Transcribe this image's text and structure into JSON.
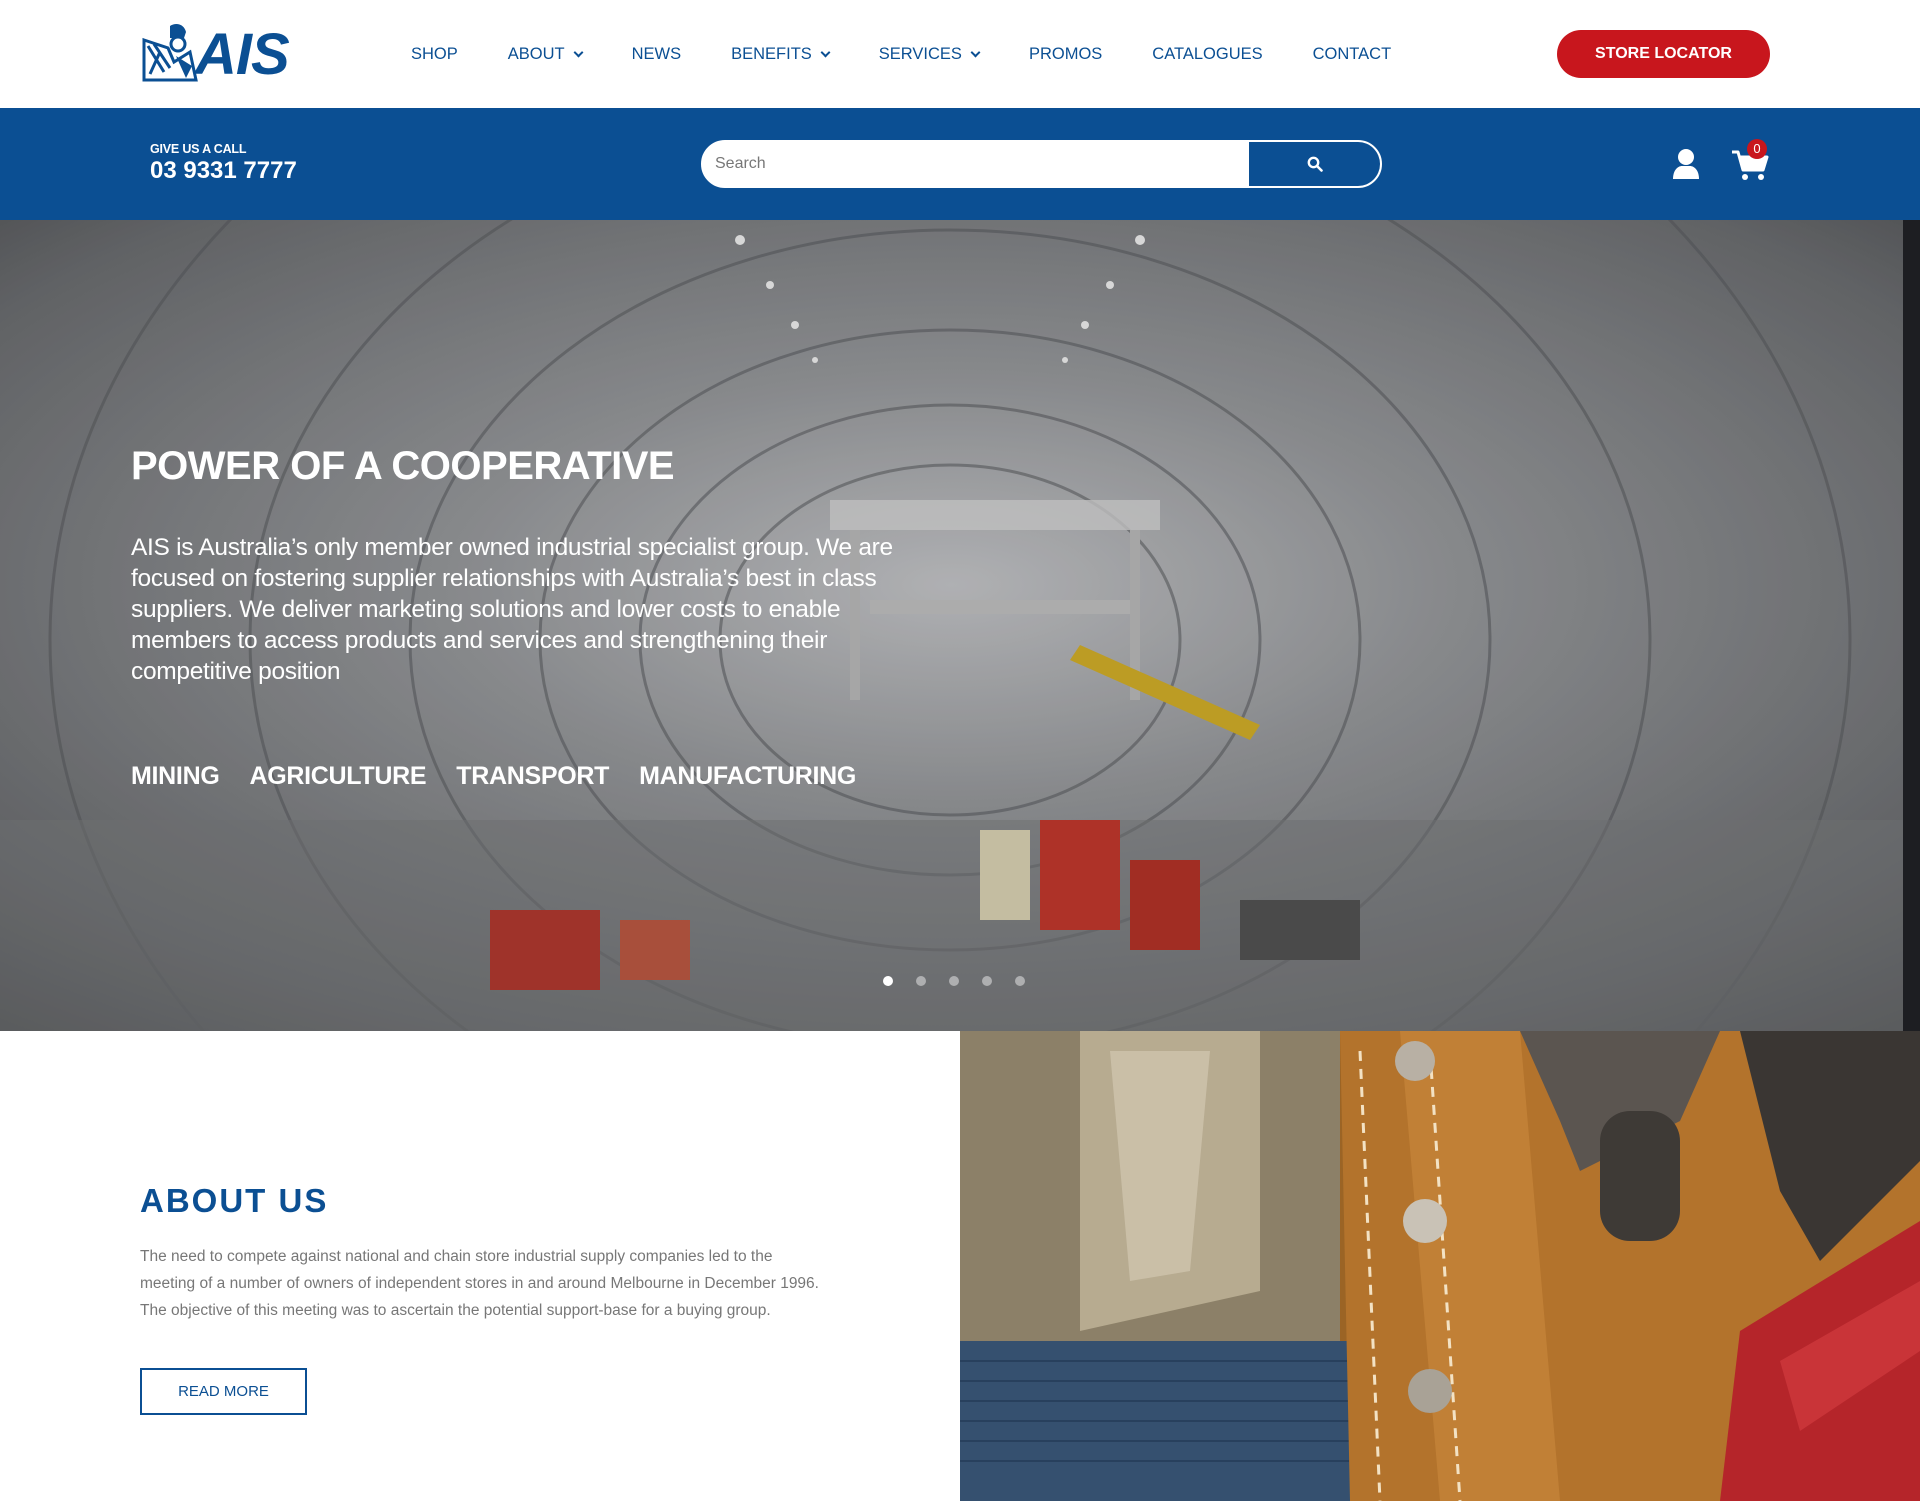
{
  "brand": {
    "logo_text": "AIS",
    "accent_color": "#0b4f93",
    "cta_color": "#c8161d"
  },
  "nav": {
    "items": [
      {
        "label": "SHOP",
        "has_dropdown": false
      },
      {
        "label": "ABOUT",
        "has_dropdown": true
      },
      {
        "label": "NEWS",
        "has_dropdown": false
      },
      {
        "label": "BENEFITS",
        "has_dropdown": true
      },
      {
        "label": "SERVICES",
        "has_dropdown": true
      },
      {
        "label": "PROMOS",
        "has_dropdown": false
      },
      {
        "label": "CATALOGUES",
        "has_dropdown": false
      },
      {
        "label": "CONTACT",
        "has_dropdown": false
      }
    ],
    "store_locator_label": "STORE LOCATOR"
  },
  "contact_bar": {
    "call_label": "GIVE US A CALL",
    "phone": "03 9331 7777",
    "search_placeholder": "Search",
    "search_icon": "search-icon",
    "user_icon": "user-icon",
    "cart_icon": "cart-icon",
    "cart_count": "0"
  },
  "hero": {
    "title": "POWER OF A COOPERATIVE",
    "text": "AIS is Australia’s only member owned industrial specialist group. We are focused on fostering supplier relationships with Australia’s best in class suppliers. We deliver marketing solutions and lower costs to enable members to access products and services and strengthening their competitive position",
    "categories": [
      "MINING",
      "AGRICULTURE",
      "TRANSPORT",
      "MANUFACTURING"
    ],
    "slide_count": 5,
    "active_slide": 1
  },
  "about": {
    "title": "ABOUT US",
    "text": "The need to compete against national and chain store industrial supply companies led to the meeting of a number of owners of independent stores in and around Melbourne in December 1996. The objective of this meeting was to ascertain the potential support-base for a buying group.",
    "button_label": "READ MORE"
  }
}
